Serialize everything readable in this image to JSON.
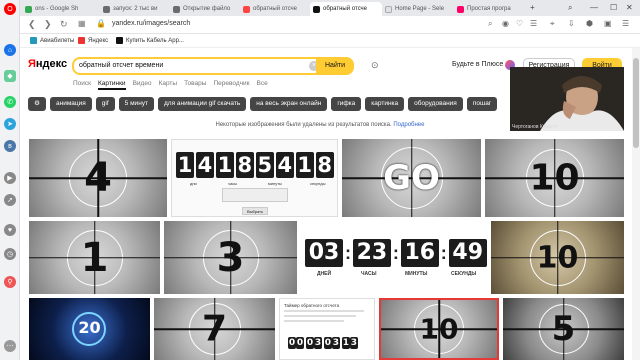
{
  "tabs": [
    {
      "label": "ons - Google Sh",
      "color": "#34a853"
    },
    {
      "label": "запуск: 2 тыс ви",
      "color": "#6b6b6b"
    },
    {
      "label": "Открытие файло",
      "color": "#6b6b6b"
    },
    {
      "label": "обратный отсче",
      "color": "#f44"
    },
    {
      "label": "обратный отсче",
      "color": "#111"
    },
    {
      "label": "Home Page - Sele",
      "color": "#e2e2e2"
    },
    {
      "label": "Простая програ",
      "color": "#f06"
    }
  ],
  "address_bar": {
    "url": "yandex.ru/images/search"
  },
  "bookmarks": [
    {
      "label": "Авиабилеты",
      "color": "#29b"
    },
    {
      "label": "Яндекс",
      "color": "#e33"
    },
    {
      "label": "Купить Кабель App...",
      "color": "#111"
    }
  ],
  "yandex": {
    "logo_a": "Я",
    "logo_b": "ндекс",
    "search_value": "обратный отсчет времени",
    "search_button": "Найти",
    "plus_label": "Будьте в Плюсе",
    "register_label": "Регистрация",
    "login_label": "Войти",
    "tabs": [
      "Поиск",
      "Картинки",
      "Видео",
      "Карты",
      "Товары",
      "Переводчик",
      "Все"
    ]
  },
  "chips": [
    "анимация",
    "gif",
    "5 минут",
    "для анимации gif скачать",
    "на весь экран онлайн",
    "гифка",
    "картинка",
    "оборудования",
    "пошаг"
  ],
  "notice": {
    "text": "Некоторые изображения были удалены из результатов поиска. ",
    "link": "Подробнее"
  },
  "webcam": {
    "label": "Чертоганов Кирилл"
  },
  "tiles": {
    "t1": "4",
    "t2_digits": [
      "1",
      "4",
      "1",
      "8",
      "5",
      "4",
      "1",
      "8"
    ],
    "t2_caps": [
      "дни",
      "часы",
      "минуты",
      "секунды"
    ],
    "t2_btn": "Выбрать",
    "t3": "GO",
    "t4": "10",
    "t5": "1",
    "t6": "3",
    "t7_groups": [
      "03",
      "23",
      "16",
      "49"
    ],
    "t7_caps": [
      "ДНЕЙ",
      "ЧАСЫ",
      "МИНУТЫ",
      "СЕКУНДЫ"
    ],
    "t8": "10",
    "t9": "20",
    "t10": "7",
    "t11_title": "Таймер обратного отсчета",
    "t11_digits": [
      "0",
      "0",
      "0",
      "3",
      "0",
      "3",
      "1",
      "3"
    ],
    "t12": "10",
    "t13": "5"
  }
}
